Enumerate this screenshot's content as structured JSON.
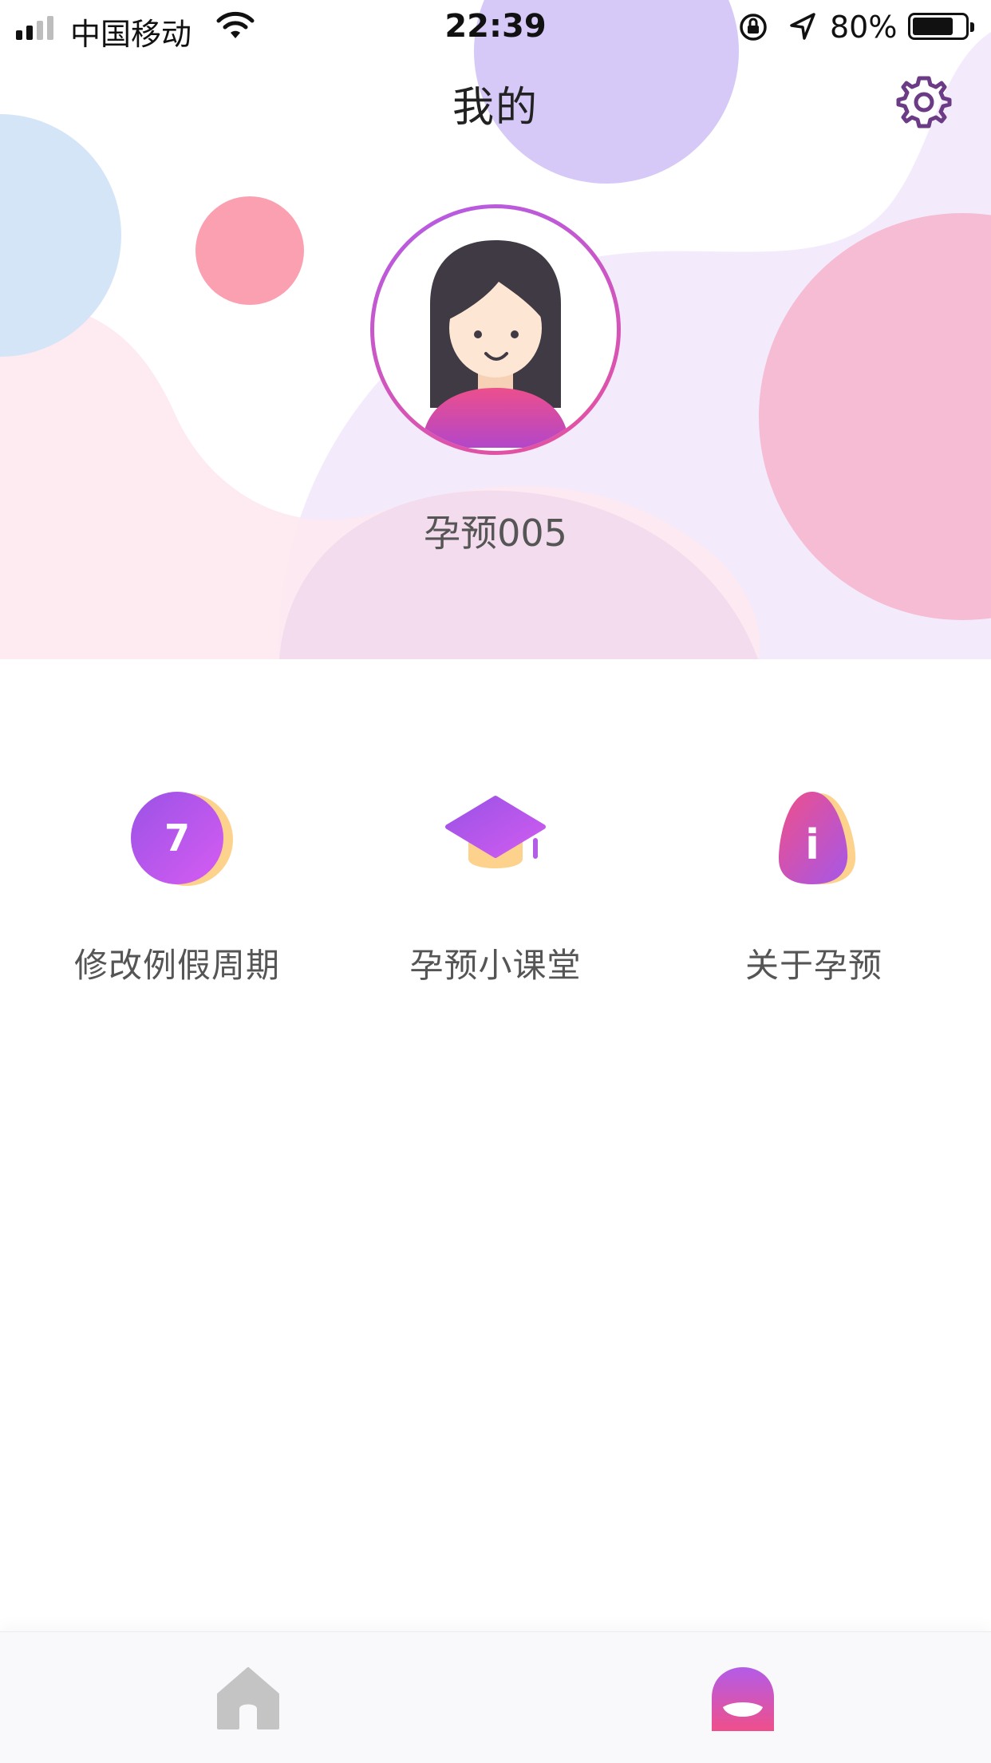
{
  "status_bar": {
    "carrier": "中国移动",
    "time": "22:39",
    "battery_percent": "80%",
    "battery_level": 0.8,
    "icons": [
      "signal-icon",
      "wifi-icon",
      "orientation-lock-icon",
      "location-icon",
      "battery-icon"
    ]
  },
  "header": {
    "title": "我的",
    "settings_icon": "gear-icon"
  },
  "profile": {
    "username": "孕预005",
    "avatar_icon": "girl-avatar-icon"
  },
  "menu": {
    "items": [
      {
        "label": "修改例假周期",
        "icon": "calendar-seven-icon",
        "icon_text": "7"
      },
      {
        "label": "孕预小课堂",
        "icon": "graduation-cap-icon"
      },
      {
        "label": "关于孕预",
        "icon": "info-icon",
        "icon_text": "i"
      }
    ]
  },
  "tabbar": {
    "tabs": [
      {
        "icon": "home-icon",
        "active": false
      },
      {
        "icon": "profile-icon",
        "active": true
      }
    ]
  },
  "colors": {
    "accent_purple": "#b35ce8",
    "accent_pink": "#e8509a",
    "inactive_tab": "#c4c4c4",
    "icon_shadow": "#fcd28c"
  }
}
